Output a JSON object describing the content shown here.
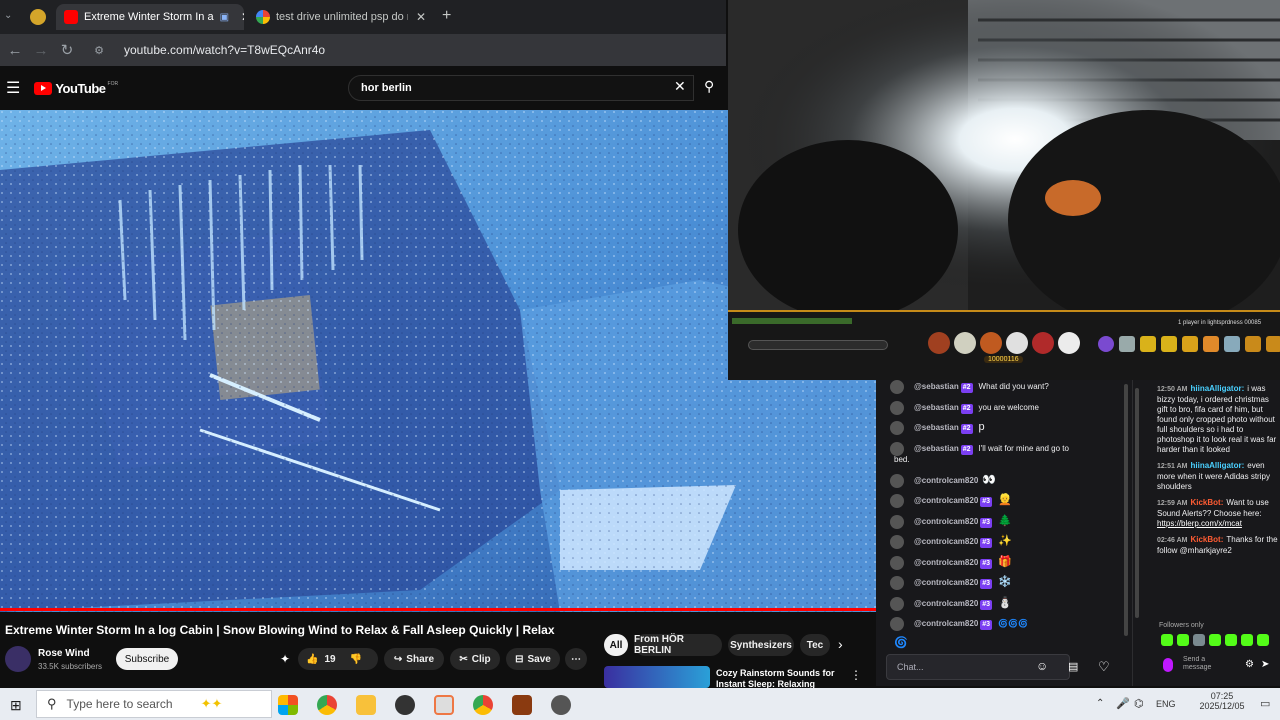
{
  "tabs": [
    {
      "label": "Extreme Winter Storm In a"
    },
    {
      "label": "test drive unlimited psp do mo"
    }
  ],
  "address": {
    "url": "youtube.com/watch?v=T8wEQcAnr4o"
  },
  "youtube": {
    "logo": "YouTube",
    "region": "FOR",
    "search_query": "hor berlin"
  },
  "video": {
    "title": "Extreme Winter Storm In a log Cabin | Snow Blowing Wind to Relax & Fall Asleep Quickly | Relax",
    "channel": "Rose Wind",
    "subscribers": "33.5K subscribers",
    "subscribe_label": "Subscribe",
    "likes": "19",
    "share_label": "Share",
    "clip_label": "Clip",
    "save_label": "Save"
  },
  "chips": [
    "All",
    "From HÖR BERLIN",
    "Synthesizers",
    "Tec"
  ],
  "recommendation": {
    "title_line1": "Cozy Rainstorm Sounds for",
    "title_line2": "Instant Sleep: Relaxing Thund"
  },
  "game_hud": {
    "status": "1 player in lightsprdness 00085",
    "score": "10000116"
  },
  "chat_left": [
    {
      "user": "@sebastian",
      "badge": "#2",
      "text": "What did you want?"
    },
    {
      "user": "@sebastian",
      "badge": "#2",
      "text": "you are welcome"
    },
    {
      "user": "@sebastian",
      "badge": "#2",
      "text": "p"
    },
    {
      "user": "@sebastian",
      "badge": "#2",
      "text": "I'll wait for mine and go to"
    },
    {
      "user": "",
      "badge": "",
      "text": "bed."
    },
    {
      "user": "@controlcam820",
      "badge": "",
      "text": "👀"
    },
    {
      "user": "@controlcam820",
      "badge": "#3",
      "text": "👱"
    },
    {
      "user": "@controlcam820",
      "badge": "#3",
      "text": "🌲"
    },
    {
      "user": "@controlcam820",
      "badge": "#3",
      "text": "✨"
    },
    {
      "user": "@controlcam820",
      "badge": "#3",
      "text": "🎁"
    },
    {
      "user": "@controlcam820",
      "badge": "#3",
      "text": "❄️"
    },
    {
      "user": "@controlcam820",
      "badge": "#3",
      "text": "⛄"
    },
    {
      "user": "@controlcam820",
      "badge": "#3",
      "text": "🌀🌀🌀"
    },
    {
      "user": "",
      "badge": "",
      "text": "🌀"
    }
  ],
  "chat_input": {
    "placeholder": "Chat..."
  },
  "chat_right": [
    {
      "time": "12:50 AM",
      "user": "hiinaAlligator:",
      "text": "i was bizzy today, i ordered christmas gift to bro, fifa card of him, but found only cropped photo without full shoulders so i had to photoshop it to look real it was far harder than it looked"
    },
    {
      "time": "12:51 AM",
      "user": "hiinaAlligator:",
      "text": "even more when it were Adidas stripy shoulders"
    },
    {
      "time": "12:59 AM",
      "user": "KickBot:",
      "text": "Want to use Sound Alerts?? Choose here:",
      "link": "https://blerp.com/x/mcat"
    },
    {
      "time": "02:46 AM",
      "user": "KickBot:",
      "text": "Thanks for the follow @mharkjayre2"
    }
  ],
  "chat_right_footer": {
    "followers_only": "Followers only",
    "send_label": "Send a message"
  },
  "taskbar": {
    "search_placeholder": "Type here to search",
    "lang": "ENG",
    "time": "07:25",
    "date": "2025/12/05"
  },
  "colors": {
    "youtube_red": "#ff0000",
    "kick_green": "#53fc18",
    "badge_purple": "#7b3ff2",
    "hud_gold": "#c68b19"
  }
}
